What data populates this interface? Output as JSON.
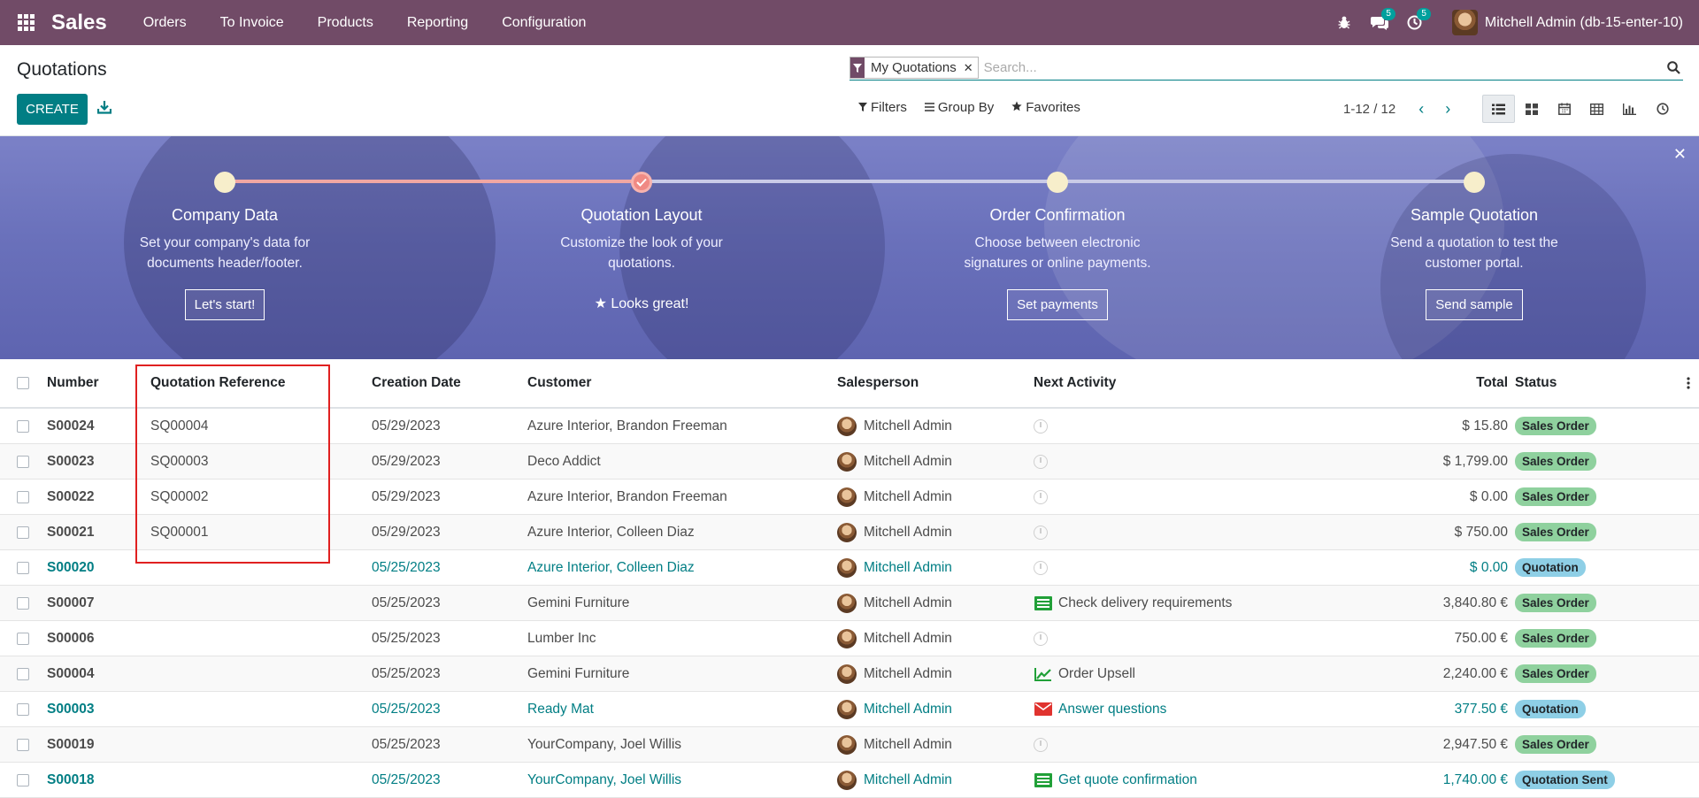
{
  "navbar": {
    "brand": "Sales",
    "menu": [
      "Orders",
      "To Invoice",
      "Products",
      "Reporting",
      "Configuration"
    ],
    "messages_count": "5",
    "activities_count": "5",
    "user": "Mitchell Admin (db-15-enter-10)"
  },
  "control_panel": {
    "title": "Quotations",
    "create_label": "CREATE",
    "facet": "My Quotations",
    "search_placeholder": "Search...",
    "filters_label": "Filters",
    "groupby_label": "Group By",
    "favorites_label": "Favorites",
    "pager": "1-12 / 12"
  },
  "onboarding": {
    "steps": [
      {
        "title": "Company Data",
        "desc1": "Set your company's data for",
        "desc2": "documents header/footer.",
        "button": "Let's start!",
        "done": false
      },
      {
        "title": "Quotation Layout",
        "desc1": "Customize the look of your",
        "desc2": "quotations.",
        "done_text": "Looks great!",
        "done": true
      },
      {
        "title": "Order Confirmation",
        "desc1": "Choose between electronic",
        "desc2": "signatures or online payments.",
        "button": "Set payments",
        "done": false
      },
      {
        "title": "Sample Quotation",
        "desc1": "Send a quotation to test the",
        "desc2": "customer portal.",
        "button": "Send sample",
        "done": false
      }
    ]
  },
  "table": {
    "headers": {
      "number": "Number",
      "reference": "Quotation Reference",
      "date": "Creation Date",
      "customer": "Customer",
      "salesperson": "Salesperson",
      "activity": "Next Activity",
      "total": "Total",
      "status": "Status"
    },
    "rows": [
      {
        "number": "S00024",
        "ref": "SQ00004",
        "date": "05/29/2023",
        "customer": "Azure Interior, Brandon Freeman",
        "salesperson": "Mitchell Admin",
        "activity": "",
        "activity_icon": "clock-icon",
        "total": "$ 15.80",
        "status": "Sales Order",
        "kind": "sales"
      },
      {
        "number": "S00023",
        "ref": "SQ00003",
        "date": "05/29/2023",
        "customer": "Deco Addict",
        "salesperson": "Mitchell Admin",
        "activity": "",
        "activity_icon": "clock-icon",
        "total": "$ 1,799.00",
        "status": "Sales Order",
        "kind": "sales"
      },
      {
        "number": "S00022",
        "ref": "SQ00002",
        "date": "05/29/2023",
        "customer": "Azure Interior, Brandon Freeman",
        "salesperson": "Mitchell Admin",
        "activity": "",
        "activity_icon": "clock-icon",
        "total": "$ 0.00",
        "status": "Sales Order",
        "kind": "sales"
      },
      {
        "number": "S00021",
        "ref": "SQ00001",
        "date": "05/29/2023",
        "customer": "Azure Interior, Colleen Diaz",
        "salesperson": "Mitchell Admin",
        "activity": "",
        "activity_icon": "clock-icon",
        "total": "$ 750.00",
        "status": "Sales Order",
        "kind": "sales"
      },
      {
        "number": "S00020",
        "ref": "",
        "date": "05/25/2023",
        "customer": "Azure Interior, Colleen Diaz",
        "salesperson": "Mitchell Admin",
        "activity": "",
        "activity_icon": "clock-icon",
        "total": "$ 0.00",
        "status": "Quotation",
        "kind": "quote"
      },
      {
        "number": "S00007",
        "ref": "",
        "date": "05/25/2023",
        "customer": "Gemini Furniture",
        "salesperson": "Mitchell Admin",
        "activity": "Check delivery requirements",
        "activity_icon": "list-icon",
        "total": "3,840.80 €",
        "status": "Sales Order",
        "kind": "sales"
      },
      {
        "number": "S00006",
        "ref": "",
        "date": "05/25/2023",
        "customer": "Lumber Inc",
        "salesperson": "Mitchell Admin",
        "activity": "",
        "activity_icon": "clock-icon",
        "total": "750.00 €",
        "status": "Sales Order",
        "kind": "sales"
      },
      {
        "number": "S00004",
        "ref": "",
        "date": "05/25/2023",
        "customer": "Gemini Furniture",
        "salesperson": "Mitchell Admin",
        "activity": "Order Upsell",
        "activity_icon": "chart-icon",
        "total": "2,240.00 €",
        "status": "Sales Order",
        "kind": "sales"
      },
      {
        "number": "S00003",
        "ref": "",
        "date": "05/25/2023",
        "customer": "Ready Mat",
        "salesperson": "Mitchell Admin",
        "activity": "Answer questions",
        "activity_icon": "envelope-icon",
        "total": "377.50 €",
        "status": "Quotation",
        "kind": "quote"
      },
      {
        "number": "S00019",
        "ref": "",
        "date": "05/25/2023",
        "customer": "YourCompany, Joel Willis",
        "salesperson": "Mitchell Admin",
        "activity": "",
        "activity_icon": "clock-icon",
        "total": "2,947.50 €",
        "status": "Sales Order",
        "kind": "sales"
      },
      {
        "number": "S00018",
        "ref": "",
        "date": "05/25/2023",
        "customer": "YourCompany, Joel Willis",
        "salesperson": "Mitchell Admin",
        "activity": "Get quote confirmation",
        "activity_icon": "list-icon",
        "total": "1,740.00 €",
        "status": "Quotation Sent",
        "kind": "sent"
      }
    ]
  },
  "colors": {
    "navbar": "#714b67",
    "primary": "#017e84",
    "banner": "#6a71bb",
    "sales_badge": "#8fd19e",
    "quotation_badge": "#8ecfe6",
    "highlight": "#e02020"
  }
}
